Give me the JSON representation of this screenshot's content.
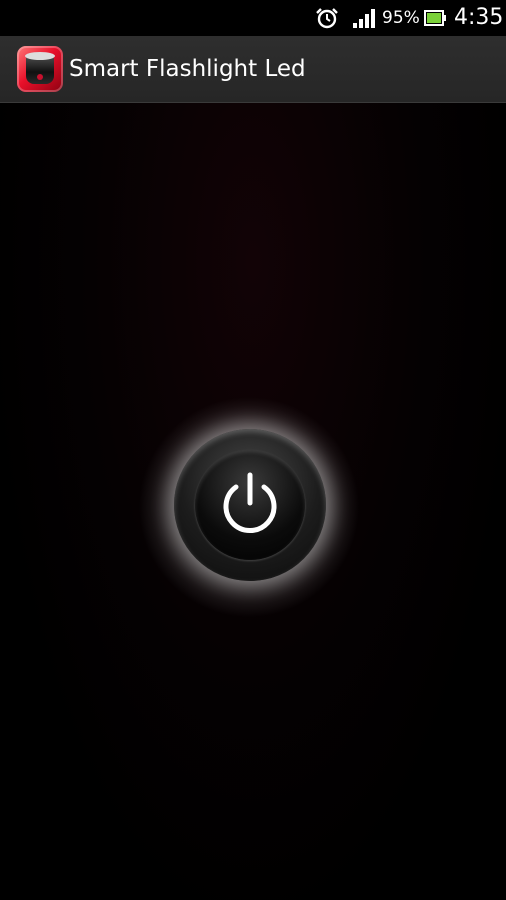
{
  "status_bar": {
    "icons": [
      "alarm-clock-icon",
      "signal-bars-icon",
      "battery-icon"
    ],
    "battery_percent": "95%",
    "time": "4:35",
    "battery_color": "#7bd13a"
  },
  "app_bar": {
    "icon": "flashlight-app-icon",
    "title": "Smart Flashlight Led",
    "accent_color": "#e8102a"
  },
  "main": {
    "power_button": {
      "icon": "power-icon",
      "state": "off"
    }
  }
}
